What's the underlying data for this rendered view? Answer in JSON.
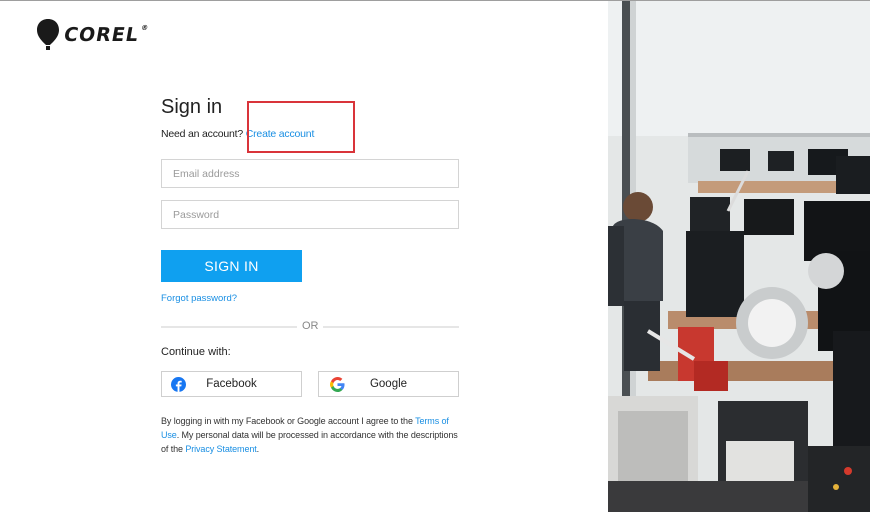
{
  "brand": {
    "name": "COREL",
    "reg_mark": "®"
  },
  "signin": {
    "title": "Sign in",
    "need_account_text": "Need an account?",
    "create_account_link": "Create account",
    "email_placeholder": "Email address",
    "password_placeholder": "Password",
    "signin_button": "SIGN IN",
    "forgot_password_link": "Forgot password?",
    "or_text": "OR",
    "continue_with": "Continue with:",
    "facebook_button": "Facebook",
    "google_button": "Google",
    "legal": {
      "part1": "By logging in with my Facebook or Google account I agree to the ",
      "terms_link": "Terms of Use",
      "part2": ". My personal data will be processed in accordance with the descriptions of the ",
      "privacy_link": "Privacy Statement",
      "part3": "."
    }
  },
  "colors": {
    "accent": "#0fa0f0",
    "link": "#1a8fe3",
    "highlight_box": "#d9343a",
    "facebook_blue": "#1877f2"
  },
  "icons": [
    "balloon-logo-icon",
    "facebook-icon",
    "google-icon"
  ]
}
